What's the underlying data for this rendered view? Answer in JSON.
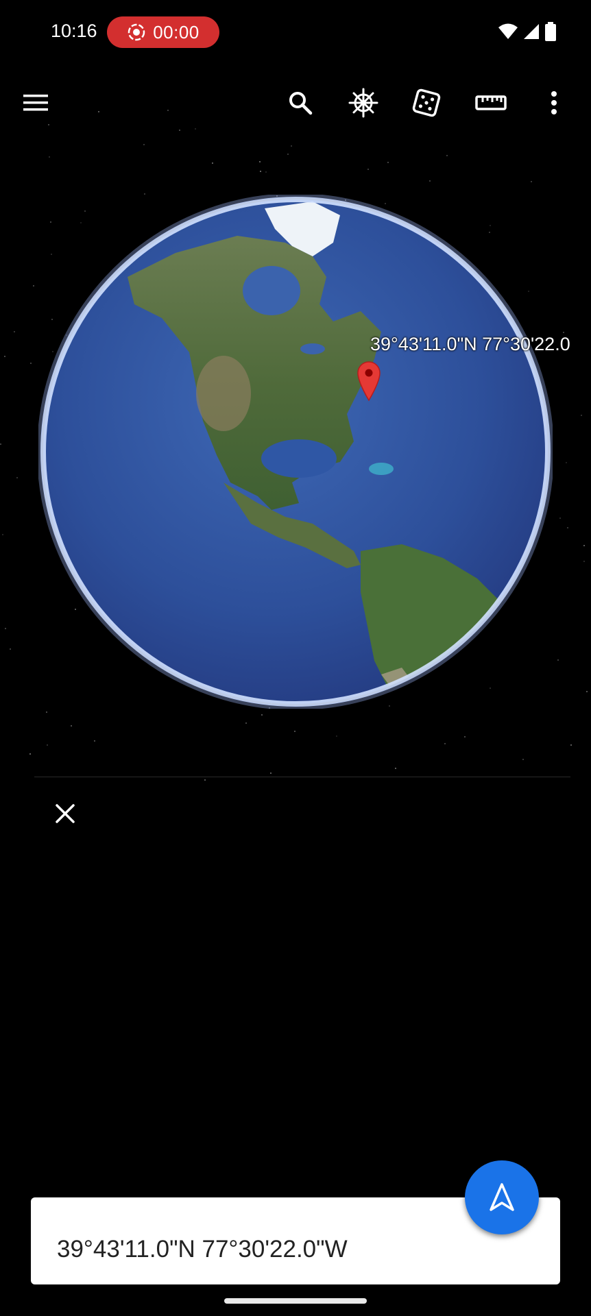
{
  "status_bar": {
    "time": "10:16",
    "recording_time": "00:00"
  },
  "toolbar": {
    "icons": [
      "menu-icon",
      "search-icon",
      "voyager-icon",
      "dice-icon",
      "ruler-icon",
      "more-vert-icon"
    ]
  },
  "map": {
    "pin_label": "39°43'11.0\"N 77°30'22.0",
    "pin_color": "#e53935"
  },
  "card": {
    "coordinates": "39°43'11.0\"N 77°30'22.0\"W"
  },
  "colors": {
    "record_pill": "#d32f2f",
    "fab": "#1a73e8",
    "background": "#000000"
  }
}
